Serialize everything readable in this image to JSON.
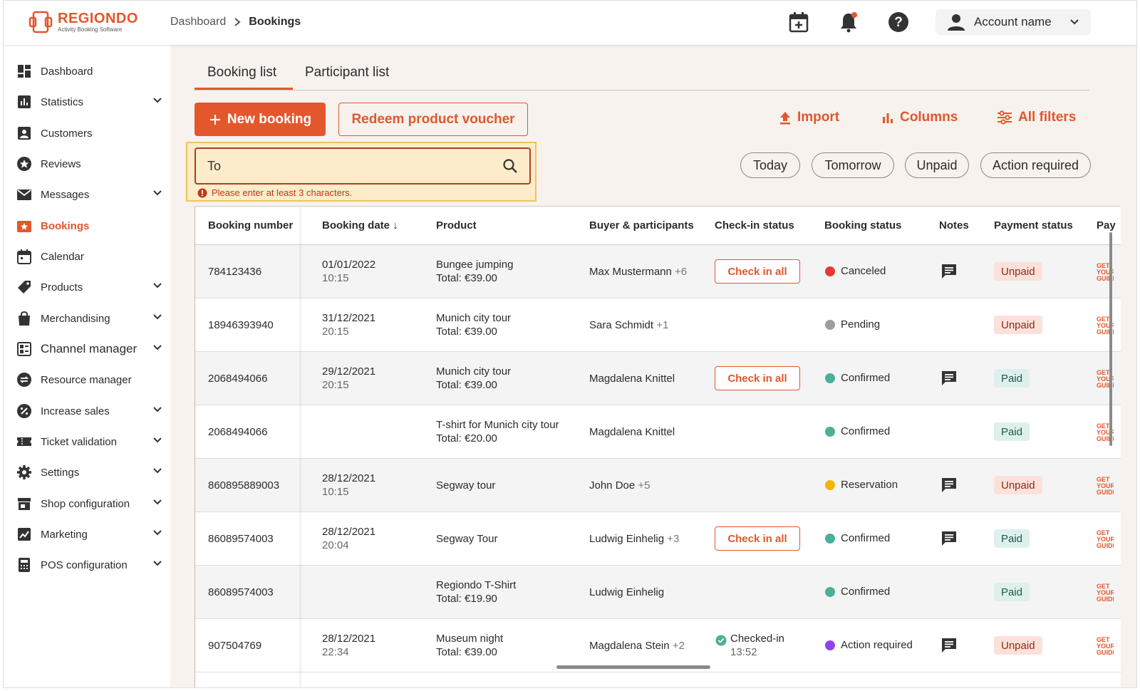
{
  "app": {
    "logo_name": "REGIONDO",
    "logo_tagline": "Activity Booking Software"
  },
  "breadcrumb": {
    "parent": "Dashboard",
    "current": "Bookings"
  },
  "header": {
    "account_name": "Account name",
    "icons": [
      "calendar-add-icon",
      "bell-icon",
      "help-icon"
    ]
  },
  "sidebar": {
    "items": [
      {
        "label": "Dashboard",
        "icon": "dashboard-icon",
        "expandable": false
      },
      {
        "label": "Statistics",
        "icon": "statistics-icon",
        "expandable": true
      },
      {
        "label": "Customers",
        "icon": "customers-icon",
        "expandable": false
      },
      {
        "label": "Reviews",
        "icon": "reviews-icon",
        "expandable": false
      },
      {
        "label": "Messages",
        "icon": "messages-icon",
        "expandable": true
      },
      {
        "label": "Bookings",
        "icon": "bookings-icon",
        "expandable": false,
        "active": true
      },
      {
        "label": "Calendar",
        "icon": "calendar-icon",
        "expandable": false
      },
      {
        "label": "Products",
        "icon": "products-icon",
        "expandable": true
      },
      {
        "label": "Merchandising",
        "icon": "merchandising-icon",
        "expandable": true
      },
      {
        "label": "Channel manager",
        "icon": "channel-manager-icon",
        "expandable": true
      },
      {
        "label": "Resource manager",
        "icon": "resource-manager-icon",
        "expandable": false
      },
      {
        "label": "Increase sales",
        "icon": "increase-sales-icon",
        "expandable": true
      },
      {
        "label": "Ticket validation",
        "icon": "ticket-validation-icon",
        "expandable": true
      },
      {
        "label": "Settings",
        "icon": "settings-icon",
        "expandable": true
      },
      {
        "label": "Shop configuration",
        "icon": "shop-icon",
        "expandable": true
      },
      {
        "label": "Marketing",
        "icon": "marketing-icon",
        "expandable": true
      },
      {
        "label": "POS configuration",
        "icon": "pos-icon",
        "expandable": true
      }
    ]
  },
  "tabs": {
    "booking_list": "Booking list",
    "participant_list": "Participant list"
  },
  "toolbar": {
    "new_booking": "New booking",
    "redeem": "Redeem product voucher",
    "import": "Import",
    "columns": "Columns",
    "all_filters": "All filters"
  },
  "search": {
    "value": "To",
    "error": "Please enter at least 3 characters."
  },
  "quick_filters": {
    "today": "Today",
    "tomorrow": "Tomorrow",
    "unpaid": "Unpaid",
    "action_required": "Action required"
  },
  "table": {
    "headers": {
      "booking_number": "Booking number",
      "booking_date": "Booking date ↓",
      "product": "Product",
      "buyer": "Buyer & participants",
      "checkin": "Check-in status",
      "booking_status": "Booking status",
      "notes": "Notes",
      "payment_status": "Payment status",
      "partial": "Pay"
    },
    "checkin_label": "Check in all",
    "guide_text": "GET YOUR GUIDE",
    "rows": [
      {
        "number": "784123436",
        "date": "01/01/2022",
        "time": "10:15",
        "product": "Bungee jumping",
        "total": "Total: €39.00",
        "buyer": "Max Mustermann",
        "extra": "+6",
        "checkin": "button",
        "status": "Canceled",
        "status_color": "#e53935",
        "note": true,
        "payment": "Unpaid"
      },
      {
        "number": "18946393940",
        "date": "31/12/2021",
        "time": "20:15",
        "product": "Munich city tour",
        "total": "Total: €39.00",
        "buyer": "Sara Schmidt",
        "extra": "+1",
        "checkin": "none",
        "status": "Pending",
        "status_color": "#9e9e9e",
        "note": false,
        "payment": "Unpaid"
      },
      {
        "number": "2068494066",
        "date": "29/12/2021",
        "time": "20:15",
        "product": "Munich city tour",
        "total": "Total: €39.00",
        "buyer": "Magdalena Knittel",
        "extra": "",
        "checkin": "button",
        "status": "Confirmed",
        "status_color": "#4caf98",
        "note": true,
        "payment": "Paid"
      },
      {
        "number": "2068494066",
        "date": "",
        "time": "",
        "product": "T-shirt for Munich city tour",
        "total": "Total: €20.00",
        "buyer": "Magdalena Knittel",
        "extra": "",
        "checkin": "none",
        "status": "Confirmed",
        "status_color": "#4caf98",
        "note": false,
        "payment": "Paid"
      },
      {
        "number": "860895889003",
        "date": "28/12/2021",
        "time": "10:15",
        "product": "Segway tour",
        "total": "",
        "buyer": "John Doe",
        "extra": "+5",
        "checkin": "none",
        "status": "Reservation",
        "status_color": "#f5b400",
        "note": true,
        "payment": "Unpaid"
      },
      {
        "number": "86089574003",
        "date": "28/12/2021",
        "time": "20:04",
        "product": "Segway Tour",
        "total": "",
        "buyer": "Ludwig Einhelig",
        "extra": "+3",
        "checkin": "button",
        "status": "Confirmed",
        "status_color": "#4caf98",
        "note": true,
        "payment": "Paid"
      },
      {
        "number": "86089574003",
        "date": "",
        "time": "",
        "product": "Regiondo T-Shirt",
        "total": "Total: €19.90",
        "buyer": "Ludwig Einhelig",
        "extra": "",
        "checkin": "none",
        "status": "Confirmed",
        "status_color": "#4caf98",
        "note": false,
        "payment": "Paid"
      },
      {
        "number": "907504769",
        "date": "28/12/2021",
        "time": "22:34",
        "product": "Museum night",
        "total": "Total: €39.00",
        "buyer": "Magdalena Stein",
        "extra": "+2",
        "checkin": "checked",
        "checkin_text": "Checked-in",
        "checkin_time": "13:52",
        "status": "Action required",
        "status_color": "#8e44ec",
        "note": true,
        "payment": "Unpaid"
      }
    ]
  },
  "colors": {
    "accent": "#e2572c",
    "search_highlight": "#fcecc9"
  }
}
